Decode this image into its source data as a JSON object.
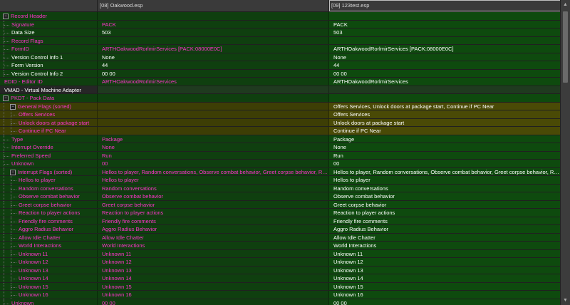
{
  "header": {
    "col0": "",
    "col1": "[08] Oakwood.esp",
    "col2": "[09] 123test.esp"
  },
  "rows": [
    {
      "label": "Record Header",
      "level": 0,
      "exp": "-",
      "style": "g",
      "lc": "conf",
      "v1": "",
      "v2": "",
      "c1": "ok",
      "c2": "ok"
    },
    {
      "label": "Signature",
      "level": 1,
      "style": "g",
      "lc": "conf",
      "v1": "PACK",
      "v2": "PACK",
      "c1": "conf",
      "c2": "ok"
    },
    {
      "label": "Data Size",
      "level": 1,
      "style": "g",
      "lc": "ok",
      "v1": "503",
      "v2": "503",
      "c1": "ok",
      "c2": "ok"
    },
    {
      "label": "Record Flags",
      "level": 1,
      "style": "g",
      "lc": "conf",
      "v1": "",
      "v2": "",
      "c1": "ok",
      "c2": "ok"
    },
    {
      "label": "FormID",
      "level": 1,
      "style": "g",
      "lc": "conf",
      "v1": "ARTHOakwoodRorlmirServices [PACK:08000E0C]",
      "v2": "ARTHOakwoodRorlmirServices [PACK:08000E0C]",
      "c1": "conf",
      "c2": "ok"
    },
    {
      "label": "Version Control Info 1",
      "level": 1,
      "style": "g",
      "lc": "ok",
      "v1": "None",
      "v2": "None",
      "c1": "ok",
      "c2": "ok"
    },
    {
      "label": "Form Version",
      "level": 1,
      "style": "g",
      "lc": "ok",
      "v1": "44",
      "v2": "44",
      "c1": "ok",
      "c2": "ok"
    },
    {
      "label": "Version Control Info 2",
      "level": 1,
      "style": "g",
      "lc": "ok",
      "v1": "00 00",
      "v2": "00 00",
      "c1": "ok",
      "c2": "ok"
    },
    {
      "label": "EDID - Editor ID",
      "level": 0,
      "style": "g",
      "lc": "conf",
      "v1": "ARTHOakwoodRorlmirServices",
      "v2": "ARTHOakwoodRorlmirServices",
      "c1": "conf",
      "c2": "ok"
    },
    {
      "label": "VMAD - Virtual Machine Adapter",
      "level": 0,
      "style": "d",
      "lc": "ok",
      "v1": "",
      "v2": "",
      "c1": "ok",
      "c2": "ok"
    },
    {
      "label": "PKDT - Pack Data",
      "level": 0,
      "exp": "-",
      "style": "g",
      "lc": "conf",
      "v1": "",
      "v2": "",
      "c1": "ok",
      "c2": "ok"
    },
    {
      "label": "General Flags (sorted)",
      "level": 1,
      "exp": "-",
      "style": "o",
      "lc": "conf",
      "v1": "",
      "v2": "Offers Services, Unlock doors at package start, Continue if PC Near",
      "c1": "ok",
      "c2": "ok"
    },
    {
      "label": "Offers Services",
      "level": 2,
      "style": "o",
      "lc": "conf",
      "v1": "",
      "v2": "Offers Services",
      "c1": "ok",
      "c2": "ok"
    },
    {
      "label": "Unlock doors at package start",
      "level": 2,
      "style": "o",
      "lc": "conf",
      "v1": "",
      "v2": "Unlock doors at package start",
      "c1": "ok",
      "c2": "ok"
    },
    {
      "label": "Continue if PC Near",
      "level": 2,
      "style": "o",
      "lc": "conf",
      "v1": "",
      "v2": "Continue if PC Near",
      "c1": "ok",
      "c2": "ok"
    },
    {
      "label": "Type",
      "level": 1,
      "style": "g",
      "lc": "conf",
      "v1": "Package",
      "v2": "Package",
      "c1": "conf",
      "c2": "ok"
    },
    {
      "label": "Interrupt Override",
      "level": 1,
      "style": "g",
      "lc": "conf",
      "v1": "None",
      "v2": "None",
      "c1": "conf",
      "c2": "ok"
    },
    {
      "label": "Preferred Speed",
      "level": 1,
      "style": "g",
      "lc": "conf",
      "v1": "Run",
      "v2": "Run",
      "c1": "conf",
      "c2": "ok"
    },
    {
      "label": "Unknown",
      "level": 1,
      "style": "g",
      "lc": "conf",
      "v1": "00",
      "v2": "00",
      "c1": "conf",
      "c2": "ok"
    },
    {
      "label": "Interrupt Flags (sorted)",
      "level": 1,
      "exp": "-",
      "style": "g",
      "lc": "conf",
      "v1": "Hellos to player, Random conversations, Observe combat behavior, Greet corpse behavior, Reaction to ...",
      "v2": "Hellos to player, Random conversations, Observe combat behavior, Greet corpse behavior, Reaction to ...",
      "c1": "conf",
      "c2": "ok"
    },
    {
      "label": "Hellos to player",
      "level": 2,
      "style": "g",
      "lc": "conf",
      "v1": "Hellos to player",
      "v2": "Hellos to player",
      "c1": "conf",
      "c2": "ok"
    },
    {
      "label": "Random conversations",
      "level": 2,
      "style": "g",
      "lc": "conf",
      "v1": "Random conversations",
      "v2": "Random conversations",
      "c1": "conf",
      "c2": "ok"
    },
    {
      "label": "Observe combat behavior",
      "level": 2,
      "style": "g",
      "lc": "conf",
      "v1": "Observe combat behavior",
      "v2": "Observe combat behavior",
      "c1": "conf",
      "c2": "ok"
    },
    {
      "label": "Greet corpse behavior",
      "level": 2,
      "style": "g",
      "lc": "conf",
      "v1": "Greet corpse behavior",
      "v2": "Greet corpse behavior",
      "c1": "conf",
      "c2": "ok"
    },
    {
      "label": "Reaction to player actions",
      "level": 2,
      "style": "g",
      "lc": "conf",
      "v1": "Reaction to player actions",
      "v2": "Reaction to player actions",
      "c1": "conf",
      "c2": "ok"
    },
    {
      "label": "Friendly fire comments",
      "level": 2,
      "style": "g",
      "lc": "conf",
      "v1": "Friendly fire comments",
      "v2": "Friendly fire comments",
      "c1": "conf",
      "c2": "ok"
    },
    {
      "label": "Aggro Radius Behavior",
      "level": 2,
      "style": "g",
      "lc": "conf",
      "v1": "Aggro Radius Behavior",
      "v2": "Aggro Radius Behavior",
      "c1": "conf",
      "c2": "ok"
    },
    {
      "label": "Allow Idle Chatter",
      "level": 2,
      "style": "g",
      "lc": "conf",
      "v1": "Allow Idle Chatter",
      "v2": "Allow Idle Chatter",
      "c1": "conf",
      "c2": "ok"
    },
    {
      "label": "World Interactions",
      "level": 2,
      "style": "g",
      "lc": "conf",
      "v1": "World Interactions",
      "v2": "World Interactions",
      "c1": "conf",
      "c2": "ok"
    },
    {
      "label": "Unknown 11",
      "level": 2,
      "style": "g",
      "lc": "conf",
      "v1": "Unknown 11",
      "v2": "Unknown 11",
      "c1": "conf",
      "c2": "ok"
    },
    {
      "label": "Unknown 12",
      "level": 2,
      "style": "g",
      "lc": "conf",
      "v1": "Unknown 12",
      "v2": "Unknown 12",
      "c1": "conf",
      "c2": "ok"
    },
    {
      "label": "Unknown 13",
      "level": 2,
      "style": "g",
      "lc": "conf",
      "v1": "Unknown 13",
      "v2": "Unknown 13",
      "c1": "conf",
      "c2": "ok"
    },
    {
      "label": "Unknown 14",
      "level": 2,
      "style": "g",
      "lc": "conf",
      "v1": "Unknown 14",
      "v2": "Unknown 14",
      "c1": "conf",
      "c2": "ok"
    },
    {
      "label": "Unknown 15",
      "level": 2,
      "style": "g",
      "lc": "conf",
      "v1": "Unknown 15",
      "v2": "Unknown 15",
      "c1": "conf",
      "c2": "ok"
    },
    {
      "label": "Unknown 16",
      "level": 2,
      "style": "g",
      "lc": "conf",
      "v1": "Unknown 16",
      "v2": "Unknown 16",
      "c1": "conf",
      "c2": "ok"
    },
    {
      "label": "Unknown",
      "level": 1,
      "style": "g",
      "lc": "conf",
      "v1": "00 00",
      "v2": "00 00",
      "c1": "conf",
      "c2": "ok"
    }
  ],
  "icons": {
    "expander": "collapse-box-icon",
    "scroll_up": "arrow-up-icon",
    "scroll_down": "arrow-down-icon"
  },
  "colors": {
    "conflict_text": "#ff33cc",
    "normal_text": "#ffffff",
    "row_green": "#0f3f0f",
    "row_olive": "#3d3e05"
  }
}
